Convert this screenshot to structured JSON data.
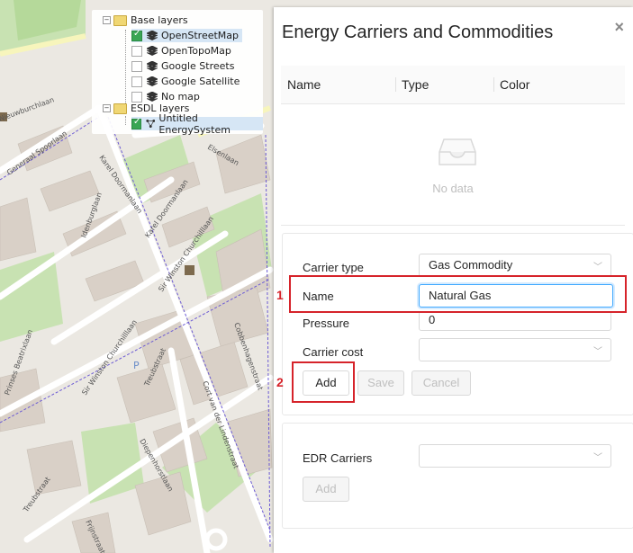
{
  "map": {
    "street_labels": [
      "Nieuwburchlaan",
      "Generaal Spoorlaan",
      "Karel Doormanlaan",
      "Idenburglaan",
      "Karel Doormanlaan",
      "Sir Winston Churchilllaan",
      "Sir Winston Churchilllaan",
      "Treubstraat",
      "Cort van der Lindenstraat",
      "Cobbenhagenstraat",
      "Diepenhorstlaan",
      "Treubstraat",
      "Frijnstraat",
      "Elsenlaan",
      "Prinses Beatrixlaan"
    ],
    "parking_marker": "P"
  },
  "layer_tree": {
    "base_group_label": "Base layers",
    "base_layers": [
      {
        "label": "OpenStreetMap",
        "checked": true,
        "selected": true
      },
      {
        "label": "OpenTopoMap",
        "checked": false,
        "selected": false
      },
      {
        "label": "Google Streets",
        "checked": false,
        "selected": false
      },
      {
        "label": "Google Satellite",
        "checked": false,
        "selected": false
      },
      {
        "label": "No map",
        "checked": false,
        "selected": false
      }
    ],
    "esdl_group_label": "ESDL layers",
    "esdl_layers": [
      {
        "label": "Untitled EnergySystem",
        "checked": true,
        "selected": true
      }
    ]
  },
  "panel": {
    "title": "Energy Carriers and Commodities",
    "close_symbol": "×",
    "table": {
      "columns": [
        "Name",
        "Type",
        "Color"
      ],
      "empty_text": "No data"
    },
    "carrier_form": {
      "carrier_type_label": "Carrier type",
      "carrier_type_value": "Gas Commodity",
      "name_label": "Name",
      "name_value": "Natural Gas",
      "pressure_label": "Pressure",
      "pressure_value": "0",
      "carrier_cost_label": "Carrier cost",
      "carrier_cost_value": "",
      "add_label": "Add",
      "save_label": "Save",
      "cancel_label": "Cancel"
    },
    "edr_form": {
      "edr_label": "EDR Carriers",
      "edr_value": "",
      "add_label": "Add"
    }
  },
  "annotations": {
    "marker_1": "1",
    "marker_2": "2",
    "color": "#d6232a"
  }
}
